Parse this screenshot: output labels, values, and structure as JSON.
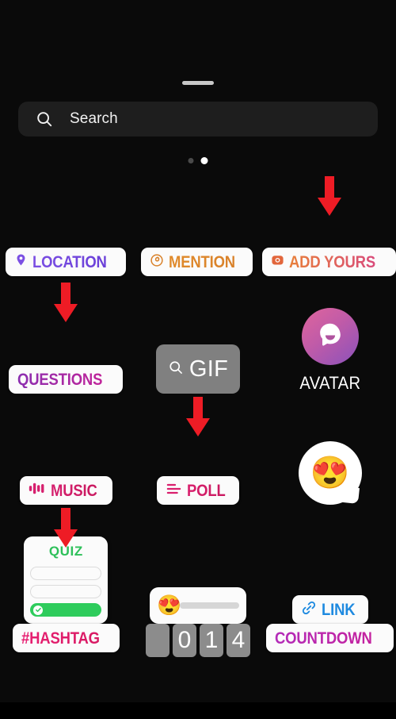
{
  "sheet": {
    "grabber": "drag-handle"
  },
  "search": {
    "placeholder": "Search",
    "value": "",
    "icon": "search-icon"
  },
  "pager": {
    "total": 2,
    "active_index": 1,
    "dots": [
      "page-dot-1",
      "page-dot-2"
    ]
  },
  "colors": {
    "background": "#0a0a0a",
    "search_field": "#1e1e1e",
    "arrow_red": "#ee1c25",
    "sticker_white": "#fbfbfb",
    "location_purple": "#7b4fe3",
    "mention_orange": "#d9822b",
    "add_yours_pink": "#d94a7a",
    "questions_magenta": "#c0249a",
    "music_pink": "#d6206e",
    "poll_pink": "#d91f6d",
    "link_blue": "#1e8ae0",
    "quiz_green": "#2ecc5c",
    "hashtag_pink": "#e81f72",
    "countdown_purple": "#b32bb8",
    "gif_gray": "#808080",
    "digit_gray": "#8c8c8c"
  },
  "stickers": {
    "row1": [
      {
        "name": "location",
        "label": "LOCATION",
        "icon": "map-pin-icon"
      },
      {
        "name": "mention",
        "label": "MENTION",
        "icon": "at-mention-icon"
      },
      {
        "name": "add-yours",
        "label": "ADD YOURS",
        "icon": "camera-icon",
        "arrow": true
      }
    ],
    "row2": [
      {
        "name": "questions",
        "label": "QUESTIONS",
        "icon": "none",
        "arrow": true
      },
      {
        "name": "gif",
        "label": "GIF",
        "icon": "search-icon"
      },
      {
        "name": "avatar",
        "label": "AVATAR",
        "icon": "avatar-face-icon"
      }
    ],
    "row3": [
      {
        "name": "music",
        "label": "MUSIC",
        "icon": "music-waveform-icon"
      },
      {
        "name": "poll",
        "label": "POLL",
        "icon": "poll-bars-icon",
        "arrow": true
      },
      {
        "name": "emoji-reaction",
        "label": "",
        "icon": "heart-eyes-emoji",
        "emoji": "😍"
      }
    ],
    "row4": [
      {
        "name": "quiz",
        "label": "QUIZ",
        "arrow": true,
        "options": [
          "",
          "",
          ""
        ],
        "correct_index": 2,
        "check_icon": "check-icon"
      },
      {
        "name": "emoji-slider",
        "label": "",
        "icon": "heart-eyes-emoji",
        "emoji": "😍",
        "fill_percent": 0
      },
      {
        "name": "link",
        "label": "LINK",
        "icon": "chain-link-icon"
      }
    ],
    "row5": [
      {
        "name": "hashtag",
        "label": "#HASHTAG"
      },
      {
        "name": "countdown-digits",
        "digits": [
          "",
          "0",
          "1",
          "4"
        ]
      },
      {
        "name": "countdown",
        "label": "COUNTDOWN"
      }
    ]
  }
}
